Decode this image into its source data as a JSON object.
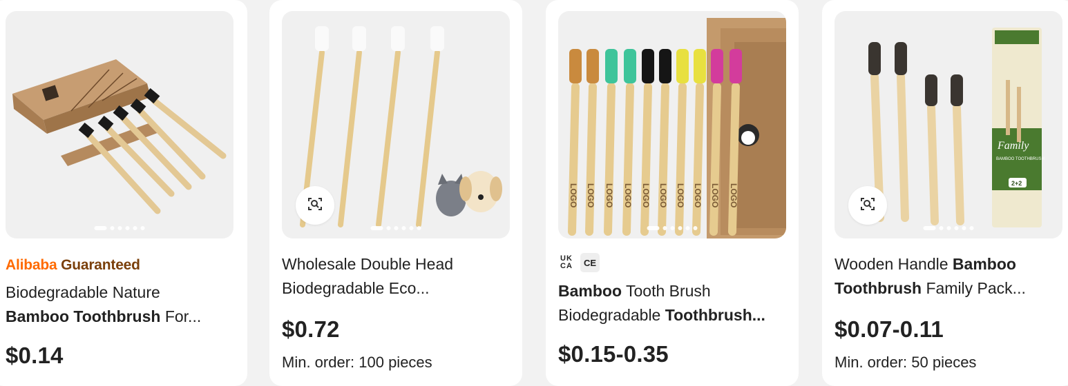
{
  "products": [
    {
      "badge_part1": "Alibaba",
      "badge_part2": "Guaranteed",
      "title_line1": "Biodegradable Nature",
      "title_bold": "Bamboo Toothbrush",
      "title_rest": "For...",
      "price": "$0.14"
    },
    {
      "title_line1": "Wholesale Double Head",
      "title_line2": "Biodegradable Eco...",
      "price": "$0.72",
      "moq": "Min. order: 100 pieces"
    },
    {
      "cert1": "UK CA",
      "cert2": "CE",
      "title_bold1": "Bamboo",
      "title_line1_rest": "Tooth Brush",
      "title_line2": "Biodegradable",
      "title_bold2": "Toothbrush...",
      "price": "$0.15-0.35",
      "image_logo_text": "LOGO"
    },
    {
      "title_line1": "Wooden Handle",
      "title_bold1": "Bamboo",
      "title_bold2": "Toothbrush",
      "title_rest": "Family Pack...",
      "price": "$0.07-0.11",
      "moq": "Min. order: 50 pieces",
      "box_label": "Family",
      "box_sub": "BAMBOO TOOTHBRUSH",
      "box_count": "2+2"
    }
  ],
  "colors": {
    "alibaba_orange": "#ff6a00",
    "guaranteed_brown": "#7a3f0a",
    "bamboo": "#e8c98f",
    "kraft": "#b98a5e"
  },
  "icons": [
    "visual-search-icon"
  ]
}
